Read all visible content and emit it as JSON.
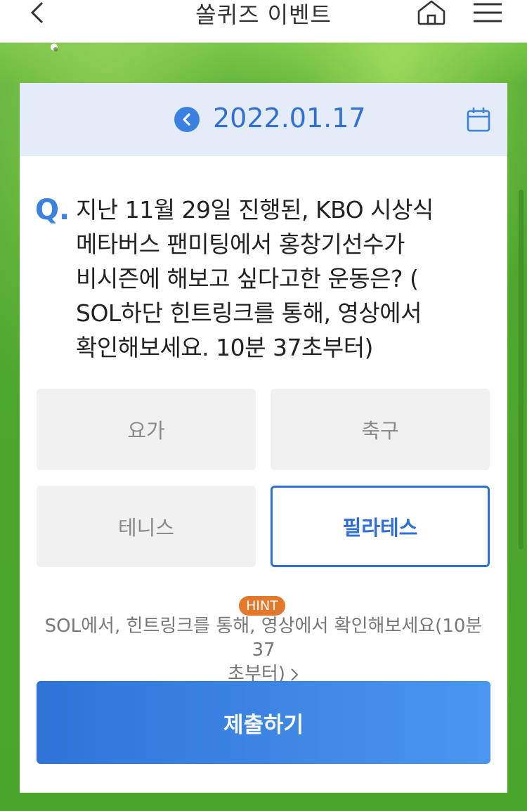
{
  "header": {
    "title": "쏠퀴즈 이벤트",
    "back_icon": "chevron-left-icon",
    "home_icon": "home-icon",
    "menu_icon": "hamburger-menu-icon"
  },
  "date_bar": {
    "date": "2022.01.17",
    "prev_icon": "circle-chevron-left-icon",
    "calendar_icon": "calendar-icon"
  },
  "question": {
    "prefix": "Q.",
    "lines": [
      "지난 11월 29일 진행된, KBO 시상식",
      "메타버스 팬미팅에서 홍창기선수가",
      "비시즌에 해보고 싶다고한 운동은? (",
      "SOL하단 힌트링크를 통해, 영상에서",
      "확인해보세요. 10분 37초부터)"
    ]
  },
  "options": [
    {
      "label": "요가",
      "selected": false
    },
    {
      "label": "축구",
      "selected": false
    },
    {
      "label": "테니스",
      "selected": false
    },
    {
      "label": "필라테스",
      "selected": true
    }
  ],
  "hint": {
    "badge": "HINT",
    "line1": "SOL에서, 힌트링크를 통해, 영상에서 확인해보세요(10분 37",
    "line2": "초부터)"
  },
  "submit_label": "제출하기",
  "colors": {
    "accent": "#2f6fd6",
    "hint_badge": "#e3782c",
    "background_green": "#4aa82e",
    "date_bar": "#e4ecf7"
  }
}
